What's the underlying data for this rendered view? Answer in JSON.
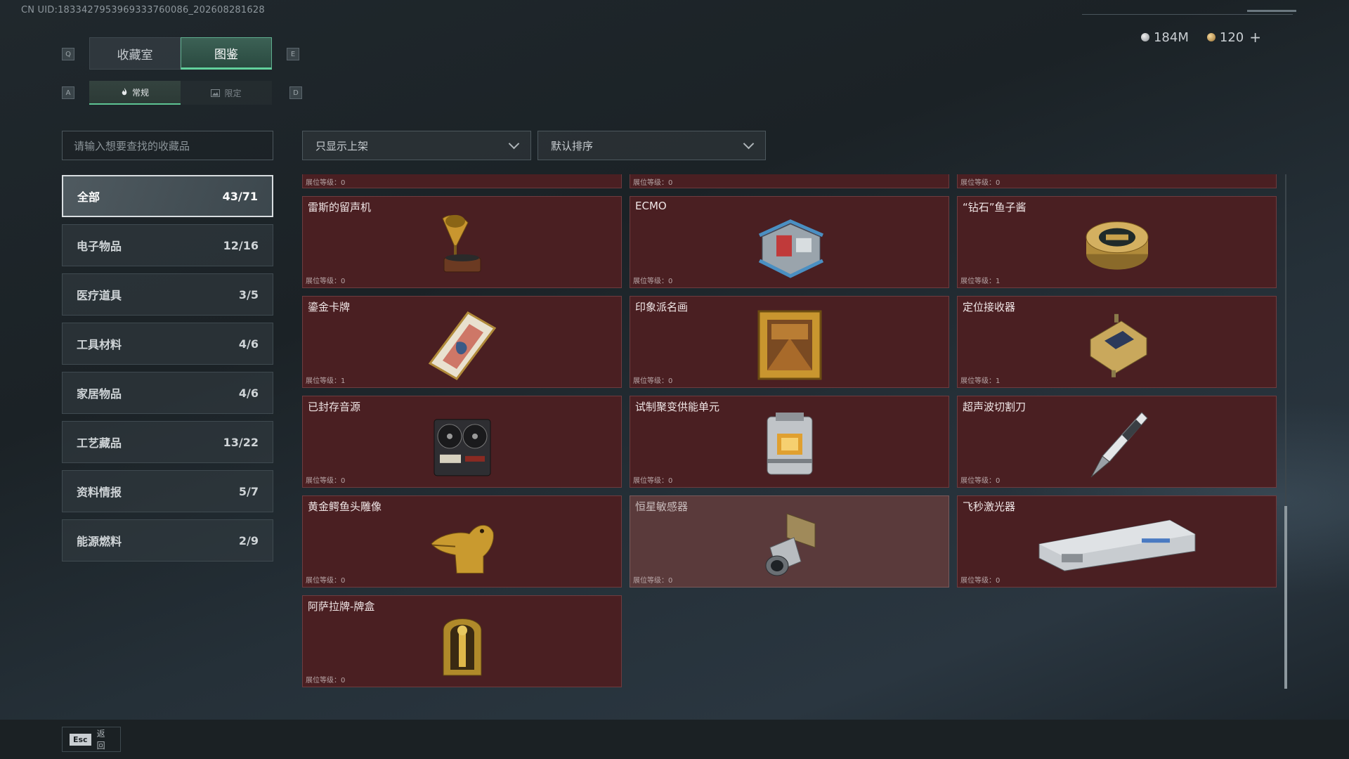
{
  "uid": "CN UID:1833427953969333760086_202608281628",
  "currency": {
    "silver": "184M",
    "gold": "120",
    "plus": "+"
  },
  "keys": {
    "q": "Q",
    "e": "E",
    "a": "A",
    "d": "D",
    "esc": "Esc"
  },
  "tabs": {
    "main": [
      "收藏室",
      "图鉴"
    ],
    "sub": [
      "常规",
      "限定"
    ]
  },
  "search": {
    "placeholder": "请输入想要查找的收藏品"
  },
  "filters": {
    "show": "只显示上架",
    "sort": "默认排序"
  },
  "categories": [
    {
      "label": "全部",
      "count": "43/71"
    },
    {
      "label": "电子物品",
      "count": "12/16"
    },
    {
      "label": "医疗道具",
      "count": "3/5"
    },
    {
      "label": "工具材料",
      "count": "4/6"
    },
    {
      "label": "家居物品",
      "count": "4/6"
    },
    {
      "label": "工艺藏品",
      "count": "13/22"
    },
    {
      "label": "资料情报",
      "count": "5/7"
    },
    {
      "label": "能源燃料",
      "count": "2/9"
    }
  ],
  "partial_row": [
    "展位等级：0",
    "展位等级：0",
    "展位等级：0"
  ],
  "items": [
    {
      "name": "雷斯的留声机",
      "level": "展位等级：0",
      "icon": "gramophone-icon"
    },
    {
      "name": "ECMO",
      "level": "展位等级：0",
      "icon": "ecmo-machine-icon"
    },
    {
      "name": "“钻石”鱼子酱",
      "level": "展位等级：1",
      "icon": "caviar-tin-icon"
    },
    {
      "name": "鎏金卡牌",
      "level": "展位等级：1",
      "icon": "gilded-card-icon"
    },
    {
      "name": "印象派名画",
      "level": "展位等级：0",
      "icon": "framed-painting-icon"
    },
    {
      "name": "定位接收器",
      "level": "展位等级：1",
      "icon": "gps-receiver-icon"
    },
    {
      "name": "已封存音源",
      "level": "展位等级：0",
      "icon": "reel-recorder-icon"
    },
    {
      "name": "试制聚变供能单元",
      "level": "展位等级：0",
      "icon": "fusion-cell-icon"
    },
    {
      "name": "超声波切割刀",
      "level": "展位等级：0",
      "icon": "ultrasonic-knife-icon"
    },
    {
      "name": "黄金鳄鱼头雕像",
      "level": "展位等级：0",
      "icon": "golden-crocodile-icon"
    },
    {
      "name": "恒星敏感器",
      "level": "展位等级：0",
      "icon": "star-sensor-icon"
    },
    {
      "name": "飞秒激光器",
      "level": "展位等级：0",
      "icon": "femtosecond-laser-icon"
    },
    {
      "name": "阿萨拉牌-牌盒",
      "level": "展位等级：0",
      "icon": "card-box-icon"
    }
  ],
  "footer": {
    "back": "返回"
  }
}
